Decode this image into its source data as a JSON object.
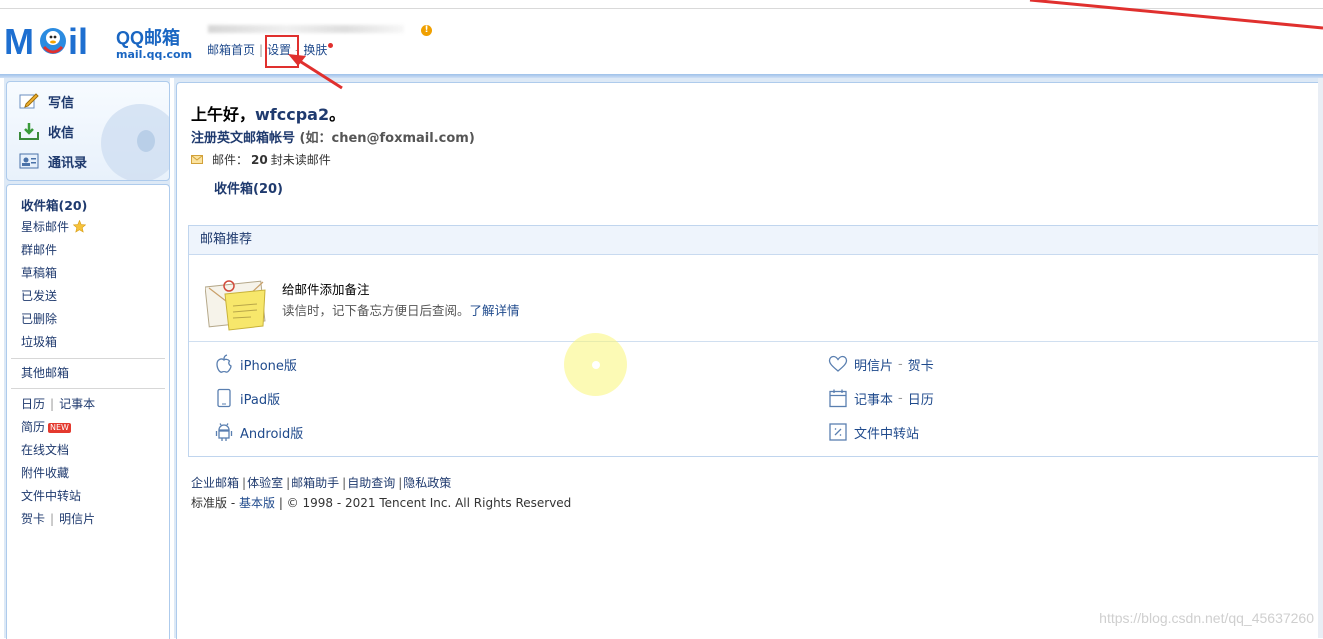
{
  "header": {
    "logo_title": "QQ邮箱",
    "logo_domain": "mail.qq.com",
    "warn_icon": "!",
    "links": {
      "home": "邮箱首页",
      "settings": "设置",
      "skin": "换肤"
    }
  },
  "sidebar": {
    "quick": {
      "compose": "写信",
      "receive": "收信",
      "contacts": "通讯录"
    },
    "folders": {
      "inbox": "收件箱(20)",
      "starred": "星标邮件",
      "groups": "群邮件",
      "drafts": "草稿箱",
      "sent": "已发送",
      "deleted": "已删除",
      "spam": "垃圾箱",
      "other": "其他邮箱",
      "calendar": "日历",
      "notes": "记事本",
      "resume": "简历",
      "resume_badge": "NEW",
      "docs": "在线文档",
      "attachments": "附件收藏",
      "transfer": "文件中转站",
      "card": "贺卡",
      "postcard": "明信片"
    }
  },
  "main": {
    "greeting_prefix": "上午好，",
    "username": "wfccpa2",
    "greeting_suffix": "。",
    "register": "注册英文邮箱帐号",
    "register_hint": "(如：chen@foxmail.com)",
    "mail_label": "邮件：",
    "unread_count": "20",
    "unread_suffix": "封未读邮件",
    "inbox_link": "收件箱(20)"
  },
  "recommend": {
    "title": "邮箱推荐",
    "note_title": "给邮件添加备注",
    "note_desc": "读信时，记下备忘方便日后查阅。",
    "note_link": "了解详情",
    "apps": {
      "iphone": "iPhone版",
      "ipad": "iPad版",
      "android": "Android版",
      "postcard": "明信片",
      "card": "贺卡",
      "notes": "记事本",
      "calendar": "日历",
      "transfer": "文件中转站"
    }
  },
  "footer": {
    "links": [
      "企业邮箱",
      "体验室",
      "邮箱助手",
      "自助查询",
      "隐私政策"
    ],
    "edition": "标准版",
    "basic": "基本版",
    "copyright": "© 1998 - 2021 Tencent Inc. All Rights Reserved"
  },
  "watermark": "https://blog.csdn.net/qq_45637260",
  "colors": {
    "accent": "#1f4a8c",
    "annotation": "#e0302e",
    "sidebar_bg": "#dde9f6"
  }
}
